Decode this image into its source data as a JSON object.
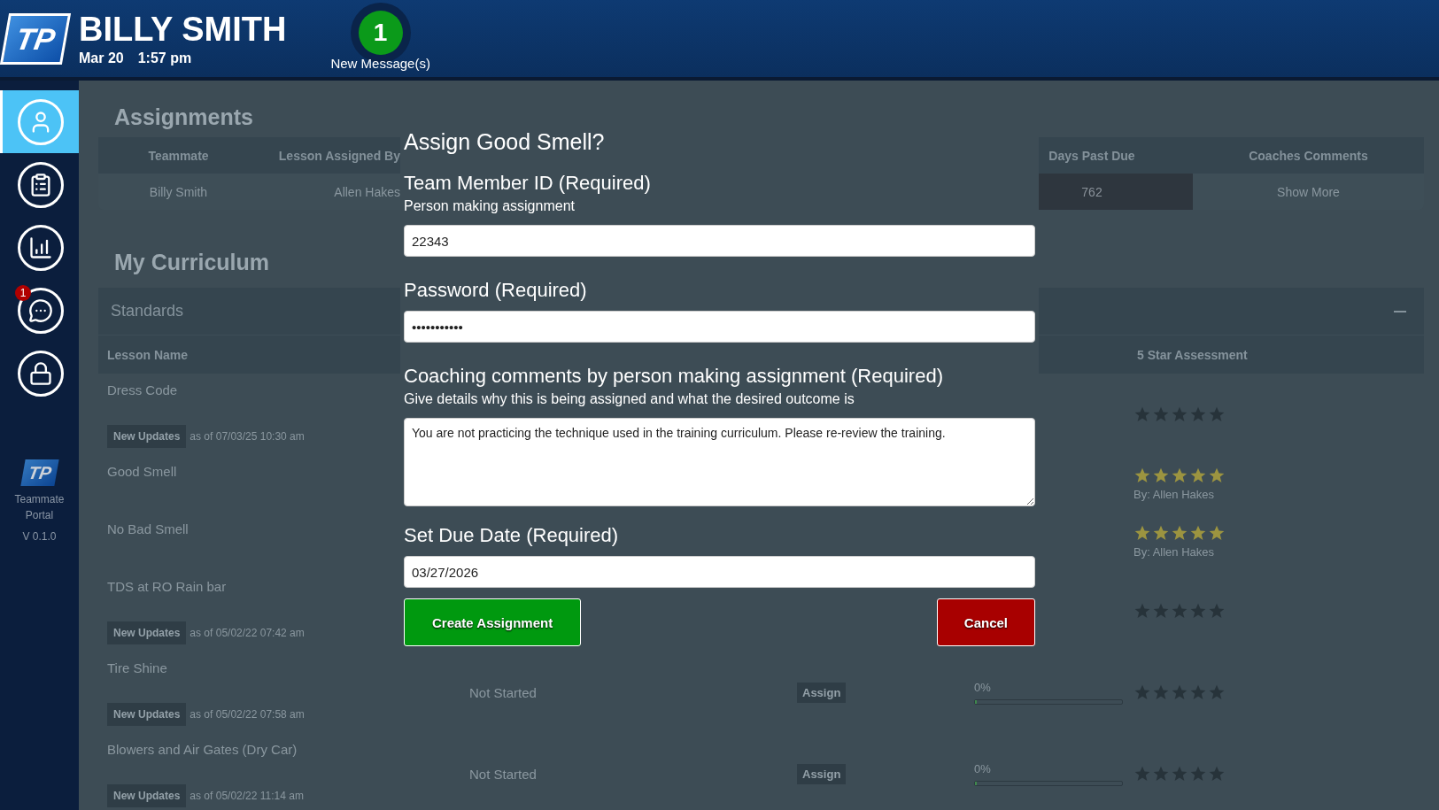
{
  "header": {
    "logo": "TP",
    "name": "BILLY SMITH",
    "date": "Mar 20",
    "time": "1:57 pm",
    "messages": {
      "count": "1",
      "label": "New Message(s)"
    }
  },
  "sidebar": {
    "items": [
      {
        "kind": "profile",
        "selected": true
      },
      {
        "kind": "lessons",
        "selected": false
      },
      {
        "kind": "progress",
        "selected": false
      },
      {
        "kind": "messages",
        "selected": false,
        "badge": "1"
      },
      {
        "kind": "logout",
        "selected": false
      }
    ],
    "logo": "TP",
    "app_name": "Teammate Portal",
    "version": "V 0.1.0"
  },
  "assignments": {
    "title": "Assignments",
    "columns": [
      "Teammate",
      "Lesson Assigned By",
      "Days Past Due",
      "Coaches Comments"
    ],
    "rows": [
      {
        "teammate": "Billy Smith",
        "assigned_by": "Allen Hakes",
        "days_past_due": "762",
        "overdue": true,
        "comments": "Show More"
      }
    ]
  },
  "curriculum": {
    "title": "My Curriculum",
    "section": "Standards",
    "expanded": true,
    "columns": [
      "Lesson Name",
      "5 Star Assessment"
    ],
    "rows": [
      {
        "name": "Dress Code",
        "update": {
          "badge": "New Updates",
          "text": "as of 07/03/25 10:30 am"
        },
        "stars": 0
      },
      {
        "name": "Good Smell",
        "stars": 5,
        "rated_by": "By: Allen Hakes"
      },
      {
        "name": "No Bad Smell",
        "stars": 5,
        "rated_by": "By: Allen Hakes"
      },
      {
        "name": "TDS at RO Rain bar",
        "update": {
          "badge": "New Updates",
          "text": "as of 05/02/22 07:42 am"
        },
        "stars": 0
      },
      {
        "name": "Tire Shine",
        "update": {
          "badge": "New Updates",
          "text": "as of 05/02/22 07:58 am"
        },
        "status": "Not Started",
        "action": "Assign",
        "progress": {
          "text": "0%",
          "level": 0
        },
        "stars": 0
      },
      {
        "name": "Blowers and Air Gates (Dry Car)",
        "update": {
          "badge": "New Updates",
          "text": "as of 05/02/22 11:14 am"
        },
        "status": "Not Started",
        "action": "Assign",
        "progress": {
          "text": "0%",
          "level": 0
        },
        "stars": 0
      }
    ]
  },
  "dialog": {
    "title": "Assign Good Smell?",
    "fields": [
      {
        "kind": "input",
        "label": "Team Member ID (Required)",
        "hint": "Person making assignment",
        "value": "22343"
      },
      {
        "kind": "input",
        "label": "Password (Required)",
        "value": "•••••••••••"
      },
      {
        "kind": "textarea",
        "label": "Coaching comments by person making assignment (Required)",
        "hint": "Give details why this is being assigned and what the desired outcome is",
        "value": "You are not practicing the technique used in the training curriculum. Please re-review the training."
      },
      {
        "kind": "input",
        "label": "Set Due Date (Required)",
        "value": "03/27/2026"
      }
    ],
    "buttons": [
      {
        "kind": "confirm",
        "label": "Create Assignment"
      },
      {
        "kind": "cancel",
        "label": "Cancel"
      }
    ]
  }
}
